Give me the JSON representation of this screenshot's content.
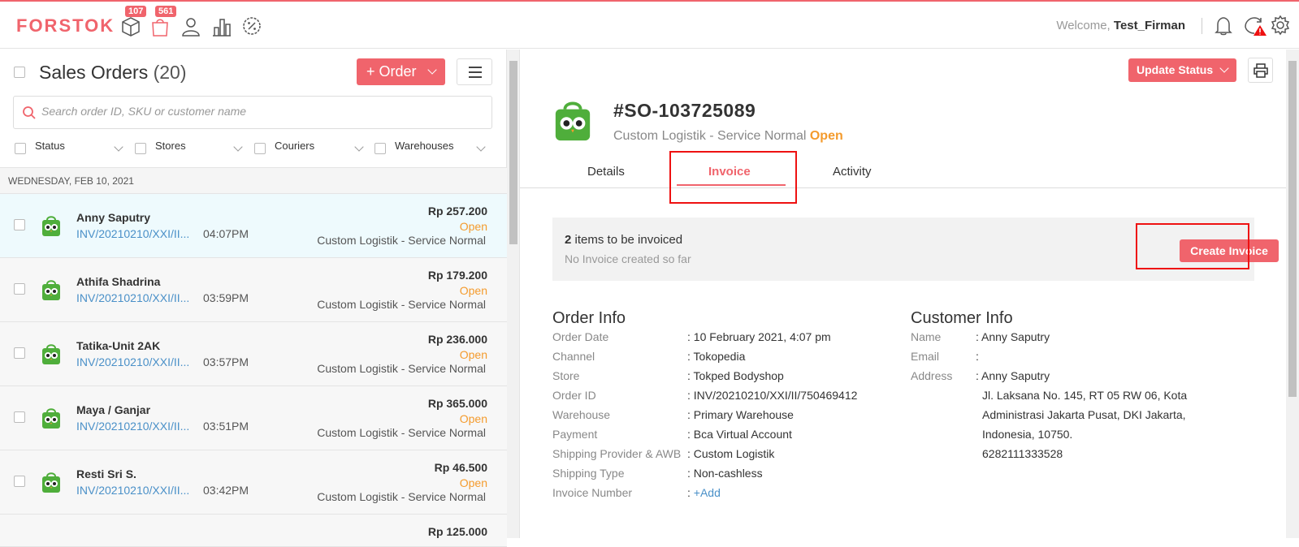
{
  "app": {
    "logo": "FORSTOK",
    "welcome_prefix": "Welcome,",
    "username": "Test_Firman"
  },
  "nav": {
    "products_badge": "107",
    "orders_badge": "561"
  },
  "list": {
    "title": "Sales Orders",
    "count": "(20)",
    "order_button": "+ Order",
    "search_placeholder": "Search order ID, SKU or customer name",
    "filters": [
      "Status",
      "Stores",
      "Couriers",
      "Warehouses"
    ],
    "date_header": "WEDNESDAY, FEB 10, 2021",
    "orders": [
      {
        "name": "Anny Saputry",
        "invoice": "INV/20210210/XXI/II...",
        "time": "04:07PM",
        "price": "Rp 257.200",
        "status": "Open",
        "shipping": "Custom Logistik - Service Normal"
      },
      {
        "name": "Athifa Shadrina",
        "invoice": "INV/20210210/XXI/II...",
        "time": "03:59PM",
        "price": "Rp 179.200",
        "status": "Open",
        "shipping": "Custom Logistik - Service Normal"
      },
      {
        "name": "Tatika-Unit 2AK",
        "invoice": "INV/20210210/XXI/II...",
        "time": "03:57PM",
        "price": "Rp 236.000",
        "status": "Open",
        "shipping": "Custom Logistik - Service Normal"
      },
      {
        "name": "Maya / Ganjar",
        "invoice": "INV/20210210/XXI/II...",
        "time": "03:51PM",
        "price": "Rp 365.000",
        "status": "Open",
        "shipping": "Custom Logistik - Service Normal"
      },
      {
        "name": "Resti Sri S.",
        "invoice": "INV/20210210/XXI/II...",
        "time": "03:42PM",
        "price": "Rp 46.500",
        "status": "Open",
        "shipping": "Custom Logistik - Service Normal"
      },
      {
        "price": "Rp 125.000"
      }
    ]
  },
  "detail": {
    "update_status": "Update Status",
    "order_no": "#SO-103725089",
    "shipping": "Custom Logistik - Service Normal",
    "status": "Open",
    "tabs": [
      "Details",
      "Invoice",
      "Activity"
    ],
    "invoice_count": "2",
    "invoice_text": "items to be invoiced",
    "invoice_sub": "No Invoice created so far",
    "create_invoice": "Create Invoice",
    "order_info": {
      "title": "Order Info",
      "rows": [
        {
          "k": "Order Date",
          "v": "10 February 2021, 4:07 pm"
        },
        {
          "k": "Channel",
          "v": "Tokopedia"
        },
        {
          "k": "Store",
          "v": "Tokped Bodyshop"
        },
        {
          "k": "Order ID",
          "v": "INV/20210210/XXI/II/750469412"
        },
        {
          "k": "Warehouse",
          "v": "Primary Warehouse"
        },
        {
          "k": "Payment",
          "v": "Bca Virtual Account"
        },
        {
          "k": "Shipping Provider & AWB",
          "v": "Custom Logistik"
        },
        {
          "k": "Shipping Type",
          "v": "Non-cashless"
        },
        {
          "k": "Invoice Number",
          "v": "+Add"
        }
      ]
    },
    "customer_info": {
      "title": "Customer Info",
      "name_k": "Name",
      "name": "Anny Saputry",
      "email_k": "Email",
      "email": "",
      "address_k": "Address",
      "address": [
        "Anny Saputry",
        "Jl. Laksana No. 145, RT 05 RW 06, Kota",
        "Administrasi Jakarta Pusat, DKI Jakarta,",
        "Indonesia, 10750.",
        "6282111333528"
      ]
    }
  }
}
